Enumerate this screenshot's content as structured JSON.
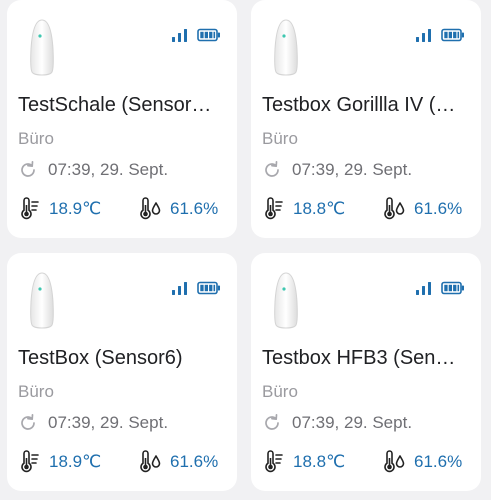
{
  "colors": {
    "background": "#f1f1f3",
    "card": "#ffffff",
    "accent": "#1f6fae",
    "muted_text": "#9a9a9f",
    "status_dot": "#3ec7b0"
  },
  "icons": {
    "device": "sensor-device-icon",
    "signal": "signal-strength-icon",
    "battery": "battery-full-icon",
    "refresh": "refresh-icon",
    "temperature": "thermometer-icon",
    "humidity": "humidity-thermometer-icon"
  },
  "cards": [
    {
      "name": "TestSchale (Sensor…",
      "room": "Büro",
      "time": "07:39, 29. Sept.",
      "temperature": "18.9℃",
      "humidity": "61.6%"
    },
    {
      "name": "Testbox Gorillla IV (…",
      "room": "Büro",
      "time": "07:39, 29. Sept.",
      "temperature": "18.8℃",
      "humidity": "61.6%"
    },
    {
      "name": "TestBox (Sensor6)",
      "room": "Büro",
      "time": "07:39, 29. Sept.",
      "temperature": "18.9℃",
      "humidity": "61.6%"
    },
    {
      "name": "Testbox HFB3 (Sen…",
      "room": "Büro",
      "time": "07:39, 29. Sept.",
      "temperature": "18.8℃",
      "humidity": "61.6%"
    }
  ]
}
